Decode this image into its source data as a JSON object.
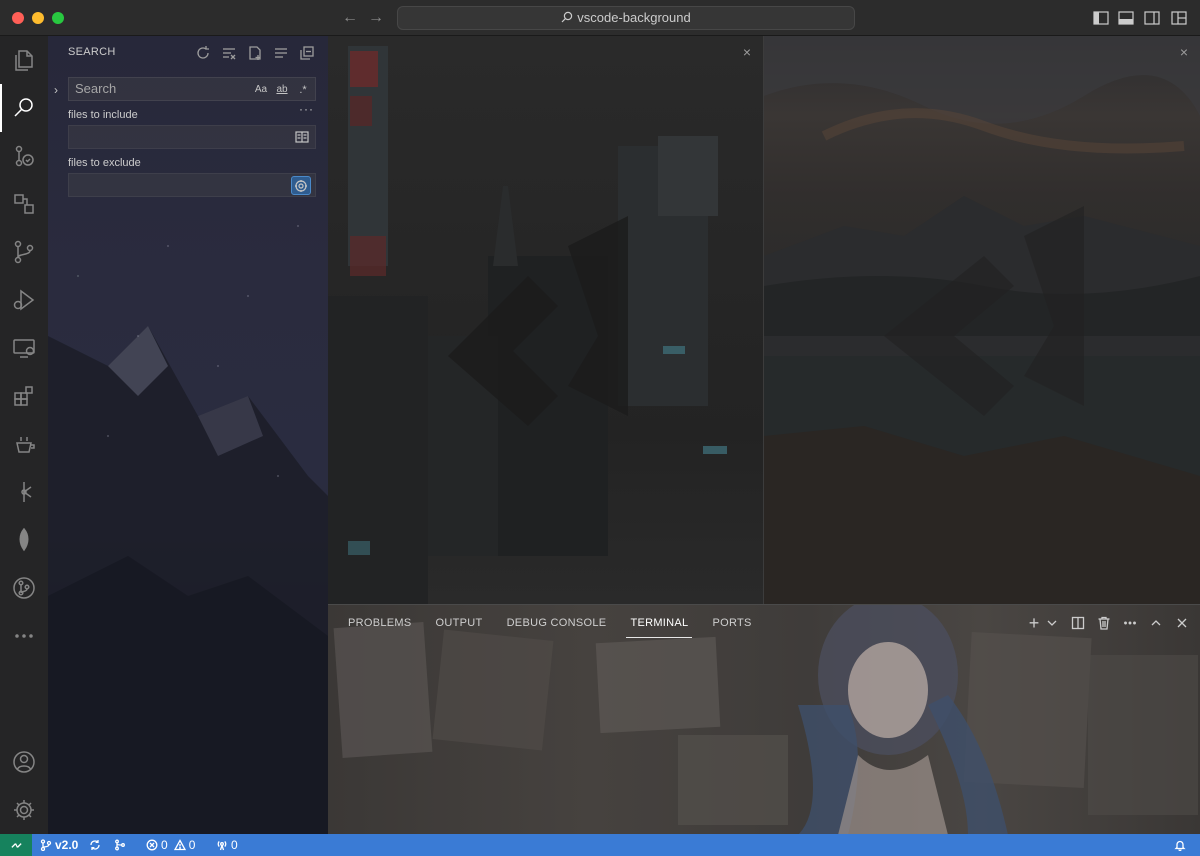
{
  "window": {
    "title": "vscode-background"
  },
  "activity_bar": {
    "items": [
      {
        "name": "explorer"
      },
      {
        "name": "search",
        "active": true
      },
      {
        "name": "source-control-graph"
      },
      {
        "name": "extensions-remote"
      },
      {
        "name": "source-control"
      },
      {
        "name": "run-and-debug"
      },
      {
        "name": "remote-explorer"
      },
      {
        "name": "extensions"
      },
      {
        "name": "testing"
      },
      {
        "name": "gitlens"
      },
      {
        "name": "mongodb"
      },
      {
        "name": "pull-requests"
      },
      {
        "name": "more"
      }
    ],
    "bottom": [
      {
        "name": "accounts"
      },
      {
        "name": "manage"
      }
    ]
  },
  "sidebar": {
    "header": "SEARCH",
    "search": {
      "placeholder": "Search",
      "value": "",
      "match_case": "Aa",
      "whole_word": "ab",
      "regex": ".*"
    },
    "more_label": "···",
    "include": {
      "label": "files to include",
      "value": ""
    },
    "exclude": {
      "label": "files to exclude",
      "value": ""
    }
  },
  "editor": {
    "close_glyph": "×"
  },
  "panel": {
    "tabs": [
      {
        "label": "PROBLEMS"
      },
      {
        "label": "OUTPUT"
      },
      {
        "label": "DEBUG CONSOLE"
      },
      {
        "label": "TERMINAL",
        "active": true
      },
      {
        "label": "PORTS"
      }
    ],
    "add_label": "+"
  },
  "status_bar": {
    "branch": "v2.0",
    "errors": "0",
    "warnings": "0",
    "ports": "0"
  },
  "colors": {
    "status_bar": "#3a7bd5",
    "remote": "#16825d",
    "activity_bar": "#252526",
    "title_bar": "#2c2c2c"
  }
}
